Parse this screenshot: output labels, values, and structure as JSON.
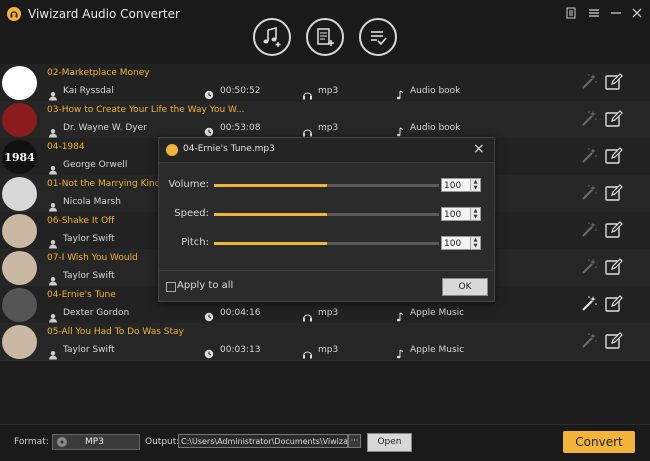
{
  "app": {
    "title": "Viwizard Audio Converter"
  },
  "toolbar": [
    "add-music-icon",
    "add-file-icon",
    "converted-list-icon"
  ],
  "tracks": [
    {
      "title": "02-Marketplace Money",
      "artist": "Kai Ryssdal",
      "duration": "00:50:52",
      "format": "mp3",
      "genre": "Audio book",
      "thumb_text": "",
      "thumb_color": "#ffffff"
    },
    {
      "title": "03-How to Create Your Life the Way You W...",
      "artist": "Dr. Wayne W. Dyer",
      "duration": "00:53:08",
      "format": "mp3",
      "genre": "Audio book",
      "thumb_text": "",
      "thumb_color": "#8a1c1c"
    },
    {
      "title": "04-1984",
      "artist": "George Orwell",
      "duration": "",
      "format": "",
      "genre": "",
      "thumb_text": "1984",
      "thumb_color": "#111111"
    },
    {
      "title": "01-Not the Marrying Kind",
      "artist": "Nicola Marsh",
      "duration": "",
      "format": "",
      "genre": "",
      "thumb_text": "",
      "thumb_color": "#d8d8d8"
    },
    {
      "title": "06-Shake It Off",
      "artist": "Taylor Swift",
      "duration": "",
      "format": "",
      "genre": "",
      "thumb_text": "",
      "thumb_color": "#c9b8a2"
    },
    {
      "title": "07-I Wish You Would",
      "artist": "Taylor Swift",
      "duration": "",
      "format": "",
      "genre": "",
      "thumb_text": "",
      "thumb_color": "#c9b8a2"
    },
    {
      "title": "04-Ernie's Tune",
      "artist": "Dexter Gordon",
      "duration": "00:04:16",
      "format": "mp3",
      "genre": "Apple Music",
      "thumb_text": "",
      "thumb_color": "#555555"
    },
    {
      "title": "05-All You Had To Do Was Stay",
      "artist": "Taylor Swift",
      "duration": "00:03:13",
      "format": "mp3",
      "genre": "Apple Music",
      "thumb_text": "",
      "thumb_color": "#c9b8a2"
    }
  ],
  "dialog": {
    "title": "04-Ernie's Tune.mp3",
    "volume_label": "Volume:",
    "speed_label": "Speed:",
    "pitch_label": "Pitch:",
    "volume": "100",
    "speed": "100",
    "pitch": "100",
    "volume_level": 0.5,
    "speed_level": 0.5,
    "pitch_level": 0.5,
    "apply_all_label": "Apply to all",
    "ok_label": "OK"
  },
  "footer": {
    "format_label": "Format:",
    "format_value": "MP3",
    "output_label": "Output:",
    "output_path": "C:\\Users\\Administrator\\Documents\\Viwizard Au",
    "browse_label": "···",
    "open_label": "Open",
    "convert_label": "Convert"
  },
  "colors": {
    "accent": "#f2b33c",
    "background": "#1c1c1c",
    "title_text": "#f2b33c"
  }
}
